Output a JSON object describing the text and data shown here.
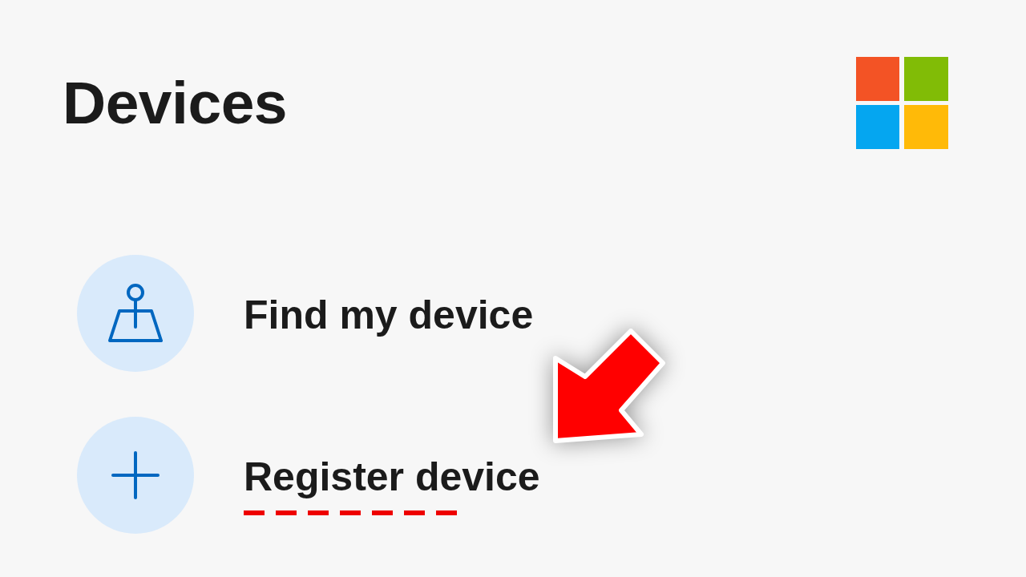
{
  "page": {
    "title": "Devices"
  },
  "items": [
    {
      "label": "Find my device",
      "kind": "find",
      "underlined": false
    },
    {
      "label": "Register device",
      "kind": "register",
      "underlined": true
    }
  ]
}
